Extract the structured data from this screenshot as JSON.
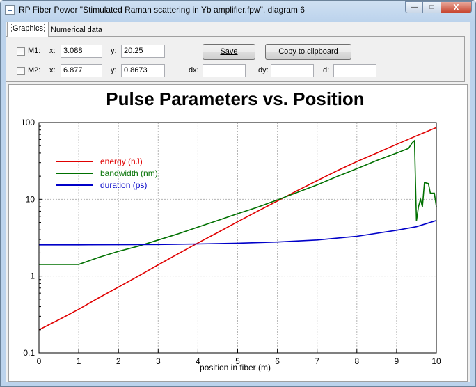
{
  "window": {
    "title": "RP Fiber Power \"Stimulated Raman scattering in Yb amplifier.fpw\", diagram 6",
    "app_icon": "app-window-icon",
    "minimize_glyph": "—",
    "maximize_glyph": "□",
    "close_glyph": "X"
  },
  "tabs": [
    {
      "label": "Graphics",
      "active": true
    },
    {
      "label": "Numerical data",
      "active": false
    }
  ],
  "markers": {
    "m1": {
      "label": "M1:",
      "x_label": "x:",
      "x_value": "3.088",
      "y_label": "y:",
      "y_value": "20.25",
      "checked": false
    },
    "m2": {
      "label": "M2:",
      "x_label": "x:",
      "x_value": "6.877",
      "y_label": "y:",
      "y_value": "0.8673",
      "checked": false
    },
    "dx_label": "dx:",
    "dx_value": "",
    "dy_label": "dy:",
    "dy_value": "",
    "d_label": "d:",
    "d_value": ""
  },
  "buttons": {
    "save_label": "Save",
    "copy_label": "Copy to clipboard"
  },
  "chart_data": {
    "type": "line",
    "title": "Pulse Parameters vs. Position",
    "xlabel": "position in fiber (m)",
    "ylabel": "",
    "xlim": [
      0,
      10
    ],
    "ylim": [
      0.1,
      100
    ],
    "yscale": "log",
    "grid": true,
    "legend_placement": "top-left",
    "x_ticks": [
      "0",
      "1",
      "2",
      "3",
      "4",
      "5",
      "6",
      "7",
      "8",
      "9",
      "10"
    ],
    "y_ticks": [
      "0.1",
      "1",
      "10",
      "100"
    ],
    "series": [
      {
        "name": "energy (nJ)",
        "color": "#e00000",
        "points": [
          [
            0,
            0.2
          ],
          [
            0.5,
            0.27
          ],
          [
            1,
            0.37
          ],
          [
            1.5,
            0.52
          ],
          [
            2,
            0.72
          ],
          [
            2.5,
            1.0
          ],
          [
            3,
            1.4
          ],
          [
            3.5,
            1.95
          ],
          [
            4,
            2.7
          ],
          [
            4.5,
            3.7
          ],
          [
            5,
            5.1
          ],
          [
            5.5,
            7.0
          ],
          [
            6,
            9.5
          ],
          [
            6.5,
            13
          ],
          [
            7,
            17.5
          ],
          [
            7.5,
            23.5
          ],
          [
            8,
            31
          ],
          [
            8.5,
            40
          ],
          [
            9,
            52
          ],
          [
            9.5,
            67
          ],
          [
            10,
            86
          ]
        ]
      },
      {
        "name": "bandwidth (nm)",
        "color": "#007000",
        "points": [
          [
            0,
            1.42
          ],
          [
            1,
            1.42
          ],
          [
            1.5,
            1.75
          ],
          [
            2,
            2.1
          ],
          [
            2.5,
            2.45
          ],
          [
            3,
            2.95
          ],
          [
            3.5,
            3.55
          ],
          [
            4,
            4.35
          ],
          [
            4.5,
            5.3
          ],
          [
            5,
            6.5
          ],
          [
            5.5,
            7.9
          ],
          [
            6,
            9.8
          ],
          [
            6.5,
            12.3
          ],
          [
            7,
            15.4
          ],
          [
            7.5,
            19.8
          ],
          [
            8,
            25
          ],
          [
            8.5,
            32
          ],
          [
            9,
            40
          ],
          [
            9.3,
            46
          ],
          [
            9.4,
            55
          ],
          [
            9.45,
            58
          ],
          [
            9.5,
            5.2
          ],
          [
            9.55,
            8
          ],
          [
            9.6,
            10
          ],
          [
            9.65,
            8
          ],
          [
            9.7,
            16.5
          ],
          [
            9.8,
            16
          ],
          [
            9.85,
            12
          ],
          [
            9.95,
            12
          ],
          [
            10,
            8
          ]
        ]
      },
      {
        "name": "duration (ps)",
        "color": "#0000c8",
        "points": [
          [
            0,
            2.55
          ],
          [
            1,
            2.55
          ],
          [
            2,
            2.56
          ],
          [
            3,
            2.58
          ],
          [
            4,
            2.62
          ],
          [
            5,
            2.68
          ],
          [
            6,
            2.78
          ],
          [
            7,
            2.95
          ],
          [
            8,
            3.3
          ],
          [
            9,
            3.95
          ],
          [
            9.5,
            4.4
          ],
          [
            10,
            5.3
          ]
        ]
      }
    ]
  }
}
